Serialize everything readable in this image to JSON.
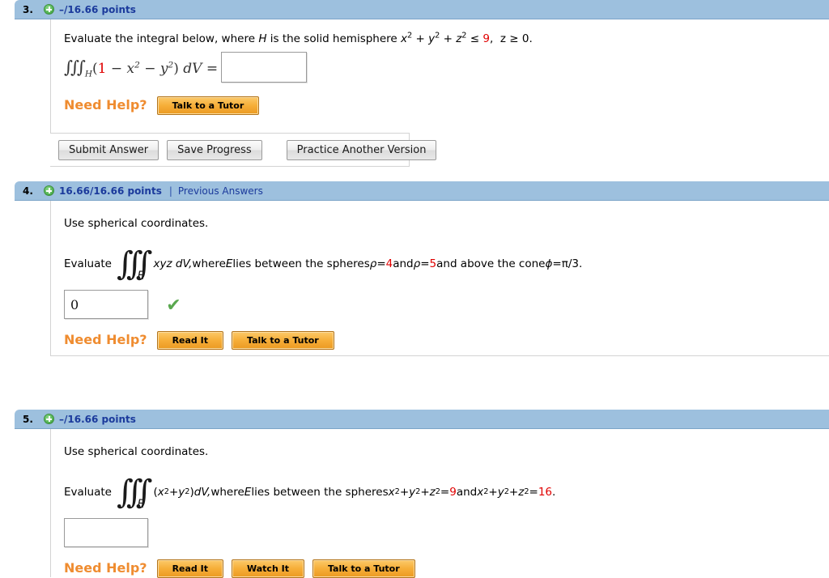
{
  "questions": [
    {
      "number": "3.",
      "points": "–/16.66 points",
      "has_previous_answers": false,
      "previous_answers_label": "",
      "separator": "|",
      "prompt_parts": {
        "a": "Evaluate the integral below, where ",
        "H": "H",
        "b": " is the solid hemisphere ",
        "x": "x",
        "sup2a": "2",
        "plus1": " + ",
        "y": "y",
        "sup2b": "2",
        "plus2": " + ",
        "z": "z",
        "sup2c": "2",
        "leq": " ≤ ",
        "radius": "9",
        "comma": ",",
        "zvar": "z",
        "geq": " ≥ ",
        "zero": "0."
      },
      "formula": {
        "integral": "∫∫∫",
        "sub": "H",
        "open": "(",
        "one": "1",
        "minus1": " − ",
        "xvar": "x",
        "xexp": "2",
        "minus2": " − ",
        "yvar": "y",
        "yexp": "2",
        "close": ")",
        "dv": "dV",
        "equals": " ="
      },
      "answer_value": "",
      "answer_placeholder": "",
      "has_checkmark": false,
      "checkmark": "",
      "need_help_label": "Need Help?",
      "help_buttons": [
        "Talk to a Tutor"
      ],
      "submit_buttons": [
        "Submit Answer",
        "Save Progress"
      ],
      "practice_button": "Practice Another Version",
      "has_submit_bar": true
    },
    {
      "number": "4.",
      "points": "16.66/16.66 points",
      "has_previous_answers": true,
      "previous_answers_label": "Previous Answers",
      "separator": "|",
      "instruction": "Use spherical coordinates.",
      "evaluate_label": "Evaluate",
      "integral_glyph": "∫∫∫",
      "integral_subscript": "E",
      "integrand": "xyz dV,",
      "condition_parts": {
        "a": " where ",
        "E": "E",
        "b": " lies between the spheres ",
        "rho1": "ρ",
        "eq1": " = ",
        "val1": "4",
        "and1": " and ",
        "rho2": "ρ",
        "eq2": " = ",
        "val2": "5",
        "and2": " and above the cone ",
        "phi": "ϕ",
        "eq3": " = ",
        "phival": "π/3."
      },
      "answer_value": "0",
      "answer_placeholder": "",
      "has_checkmark": true,
      "checkmark": "✔",
      "need_help_label": "Need Help?",
      "help_buttons": [
        "Read It",
        "Talk to a Tutor"
      ],
      "has_submit_bar": false
    },
    {
      "number": "5.",
      "points": "–/16.66 points",
      "has_previous_answers": false,
      "previous_answers_label": "",
      "separator": "|",
      "instruction": "Use spherical coordinates.",
      "evaluate_label": "Evaluate",
      "integral_glyph": "∫∫∫",
      "integral_subscript": "E",
      "integrand_parts": {
        "open": "(",
        "x": "x",
        "xexp": "2",
        "plus": " + ",
        "y": "y",
        "yexp": "2",
        "close": ")",
        "dv": " dV,"
      },
      "condition_parts": {
        "a": " where ",
        "E": "E",
        "b": " lies between the spheres  ",
        "x1": "x",
        "x1e": "2",
        "p1": " + ",
        "y1": "y",
        "y1e": "2",
        "p2": " + ",
        "z1": "z",
        "z1e": "2",
        "eq1": " = ",
        "val1": "9",
        "and": " and ",
        "x2": "x",
        "x2e": "2",
        "p3": " + ",
        "y2": "y",
        "y2e": "2",
        "p4": " + ",
        "z2": "z",
        "z2e": "2",
        "eq2": " = ",
        "val2": "16",
        "period": "."
      },
      "answer_value": "",
      "answer_placeholder": "",
      "has_checkmark": false,
      "checkmark": "",
      "need_help_label": "Need Help?",
      "help_buttons": [
        "Read It",
        "Watch It",
        "Talk to a Tutor"
      ],
      "has_submit_bar": false
    }
  ],
  "colors": {
    "header_bg": "#9dc0de",
    "points_text": "#1b3a9c",
    "red_value": "#e00000",
    "help_orange": "#ef8c30",
    "check_green": "#5aa84f"
  }
}
